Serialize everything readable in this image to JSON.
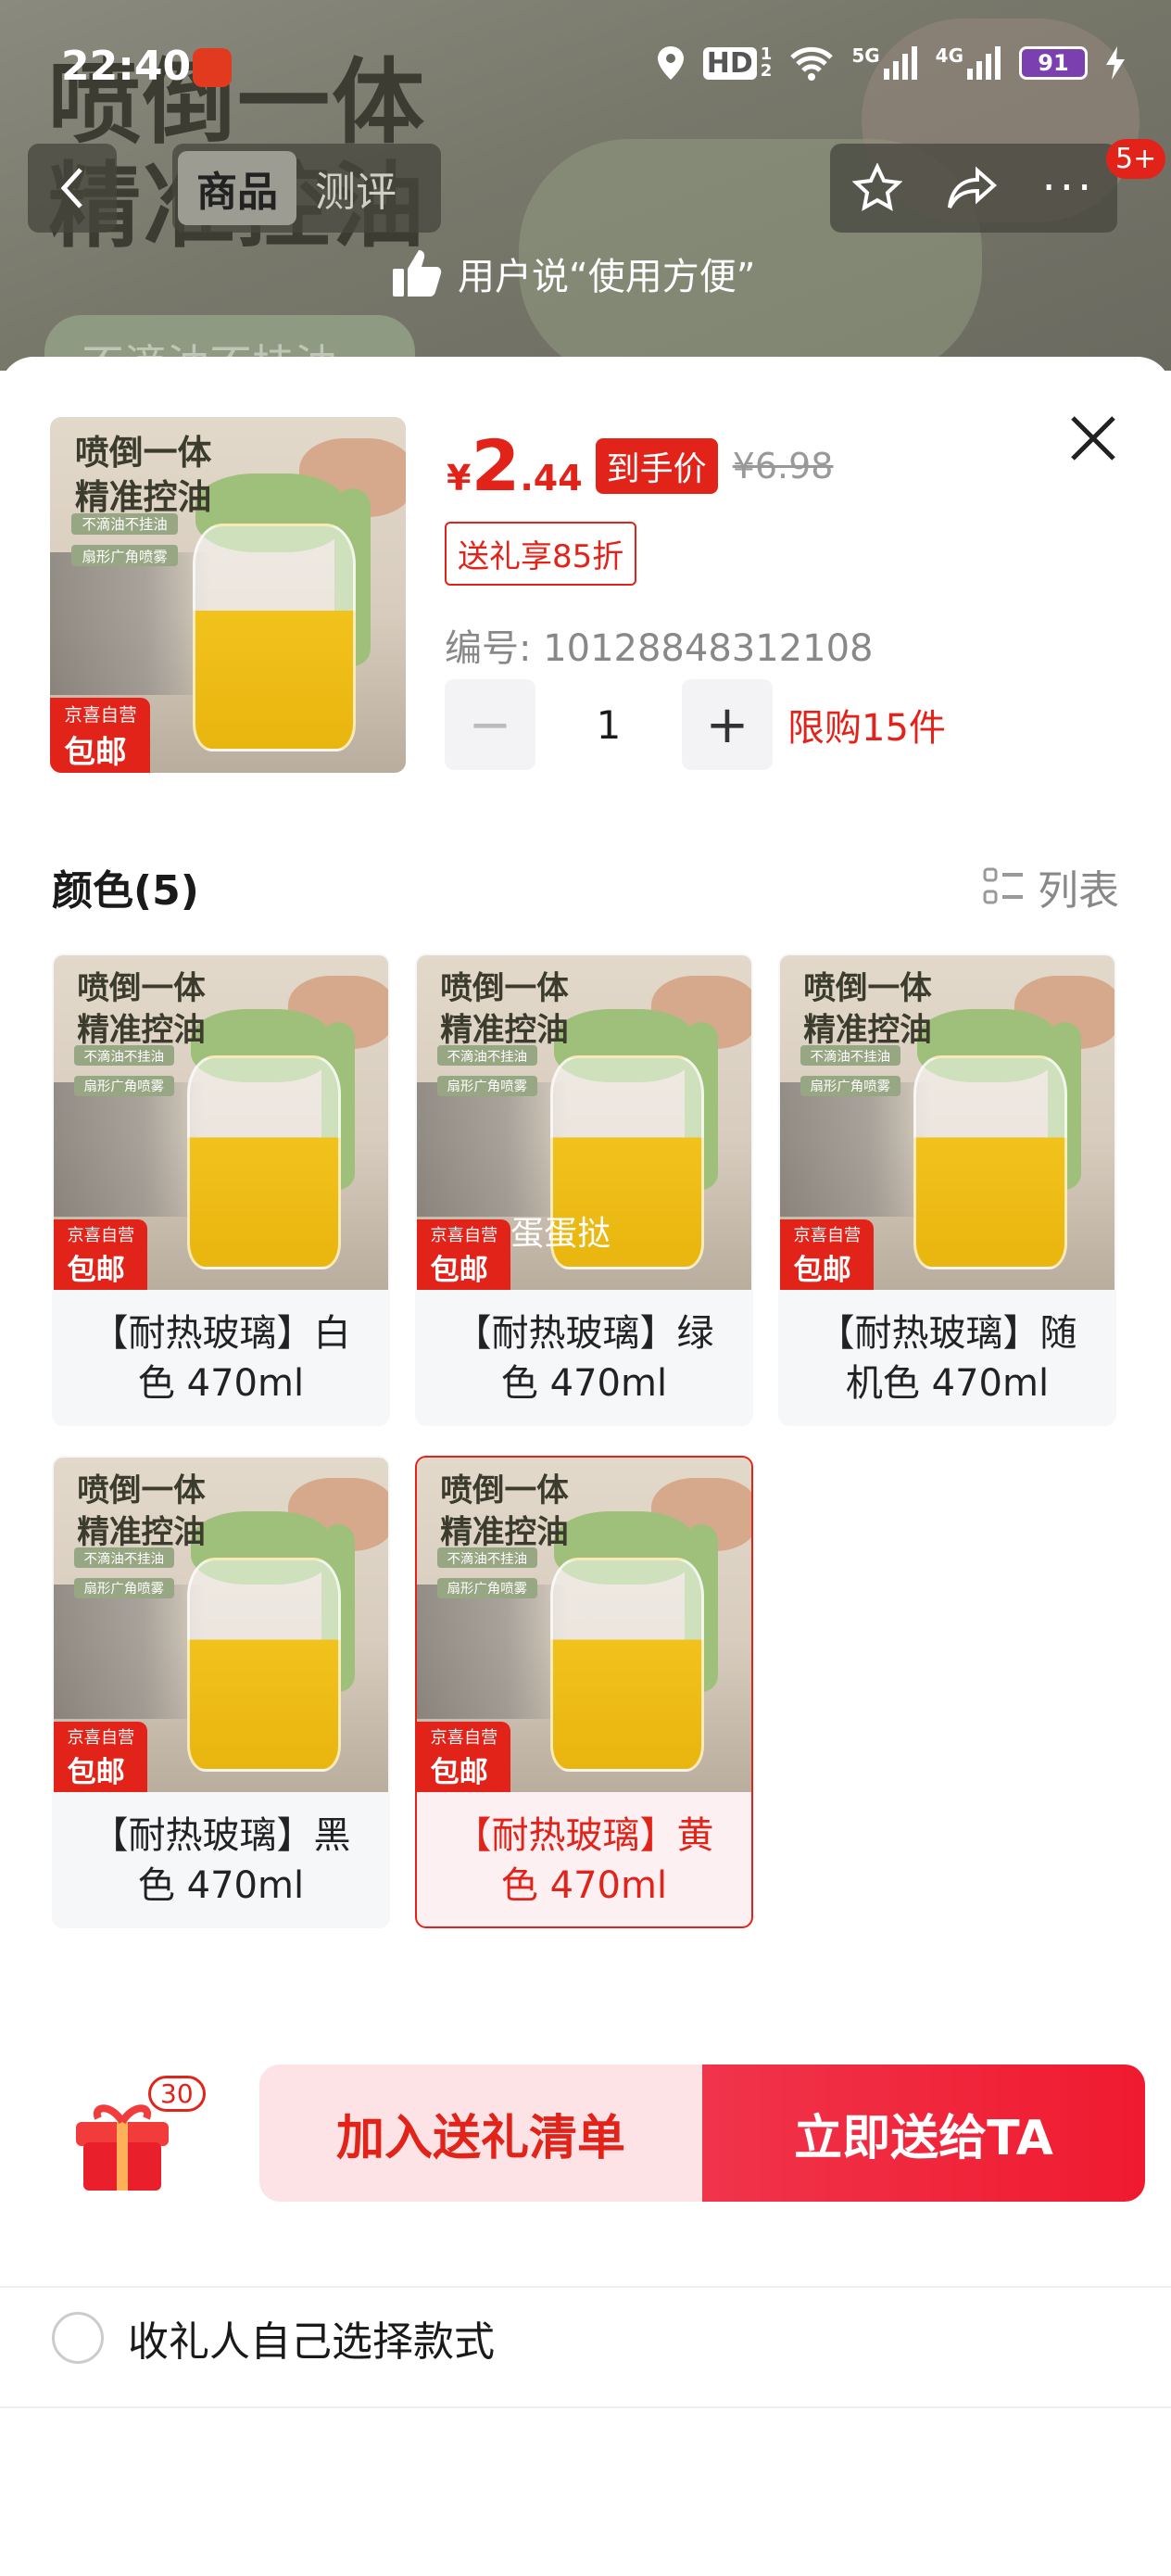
{
  "status_bar": {
    "time": "22:40",
    "hd": "HD",
    "sim1": "1",
    "sim2": "2",
    "net1": "5G",
    "net2": "4G",
    "battery": "91"
  },
  "background": {
    "hero_title_line1": "喷倒一体",
    "hero_title_line2": "精准控油",
    "hero_tag": "不滴油不挂油"
  },
  "nav": {
    "tabs": [
      {
        "label": "商品",
        "active": true
      },
      {
        "label": "测评",
        "active": false
      }
    ],
    "more_badge": "5+",
    "user_says": "用户说“使用方便”"
  },
  "product": {
    "thumb_text": {
      "title_line1": "喷倒一体",
      "title_line2": "精准控油",
      "pill1": "不滴油不挂油",
      "pill2": "扇形广角喷雾",
      "jd_small": "京喜自营",
      "jd_big": "包邮"
    },
    "price_symbol": "¥",
    "price_int": "2",
    "price_dec": ".44",
    "to_hand_label": "到手价",
    "original_price": "¥6.98",
    "gift_discount": "送礼享85折",
    "sku": "编号: 10128848312108",
    "quantity": "1",
    "minus": "−",
    "plus": "+",
    "limit": "限购15件"
  },
  "colors_section": {
    "title": "颜色(5)",
    "list_label": "列表",
    "options": [
      {
        "label": "【耐热玻璃】白色 470ml",
        "selected": false,
        "watermark": ""
      },
      {
        "label": "【耐热玻璃】绿色 470ml",
        "selected": false,
        "watermark": "蛋蛋挞"
      },
      {
        "label": "【耐热玻璃】随机色 470ml",
        "selected": false,
        "watermark": ""
      },
      {
        "label": "【耐热玻璃】黑色 470ml",
        "selected": false,
        "watermark": ""
      },
      {
        "label": "【耐热玻璃】黄色 470ml",
        "selected": true,
        "watermark": ""
      }
    ]
  },
  "self_select": {
    "label": "收礼人自己选择款式",
    "checked": false
  },
  "footer": {
    "gift_count": "30",
    "add_label": "加入送礼清单",
    "send_label": "立即送给TA"
  },
  "colors": {
    "accent": "#e2231a",
    "selected_bg": "#fdf0f2",
    "add_bg": "#fde3e5"
  }
}
